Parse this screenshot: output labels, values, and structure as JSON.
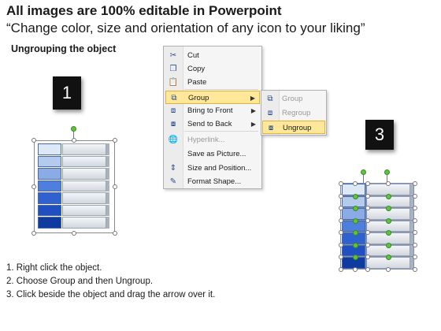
{
  "header": {
    "title": "All images are 100% editable in Powerpoint",
    "subtitle": "“Change color, size and orientation of any icon to your liking”"
  },
  "section": {
    "heading": "Ungrouping the object"
  },
  "steps": {
    "step1": "1",
    "step3": "3"
  },
  "context_menu": {
    "items": [
      {
        "label": "Cut",
        "icon": "scissors-icon",
        "glyph": "✂",
        "state": "normal"
      },
      {
        "label": "Copy",
        "icon": "copy-icon",
        "glyph": "❐",
        "state": "normal"
      },
      {
        "label": "Paste",
        "icon": "paste-icon",
        "glyph": "📋",
        "state": "normal"
      },
      {
        "label": "Group",
        "icon": "group-icon",
        "glyph": "⧉",
        "state": "highlighted",
        "submenu": true
      },
      {
        "label": "Bring to Front",
        "icon": "bring-to-front-icon",
        "glyph": "⧈",
        "state": "normal",
        "submenu": true
      },
      {
        "label": "Send to Back",
        "icon": "send-to-back-icon",
        "glyph": "⧇",
        "state": "normal",
        "submenu": true
      },
      {
        "label": "Hyperlink...",
        "icon": "hyperlink-icon",
        "glyph": "🌐",
        "state": "disabled"
      },
      {
        "label": "Save as Picture...",
        "icon": "",
        "glyph": "",
        "state": "normal"
      },
      {
        "label": "Size and Position...",
        "icon": "size-position-icon",
        "glyph": "⇕",
        "state": "normal"
      },
      {
        "label": "Format Shape...",
        "icon": "format-shape-icon",
        "glyph": "✎",
        "state": "normal"
      }
    ]
  },
  "submenu": {
    "items": [
      {
        "label": "Group",
        "icon": "group-icon",
        "glyph": "⧉",
        "state": "disabled"
      },
      {
        "label": "Regroup",
        "icon": "regroup-icon",
        "glyph": "⧈",
        "state": "disabled"
      },
      {
        "label": "Ungroup",
        "icon": "ungroup-icon",
        "glyph": "⧇",
        "state": "highlighted"
      }
    ]
  },
  "instructions": [
    "1.  Right click the object.",
    "2.  Choose Group and then Ungroup.",
    "3.  Click beside the object and drag the arrow over it."
  ],
  "colors": {
    "bar_shades": [
      "#dde8f7",
      "#b5cbee",
      "#8aabe6",
      "#4f7fde",
      "#2f62d0",
      "#1f4fc0",
      "#0f3aa0"
    ],
    "highlight": "#ffe89a",
    "handle_green": "#5ec43d"
  }
}
